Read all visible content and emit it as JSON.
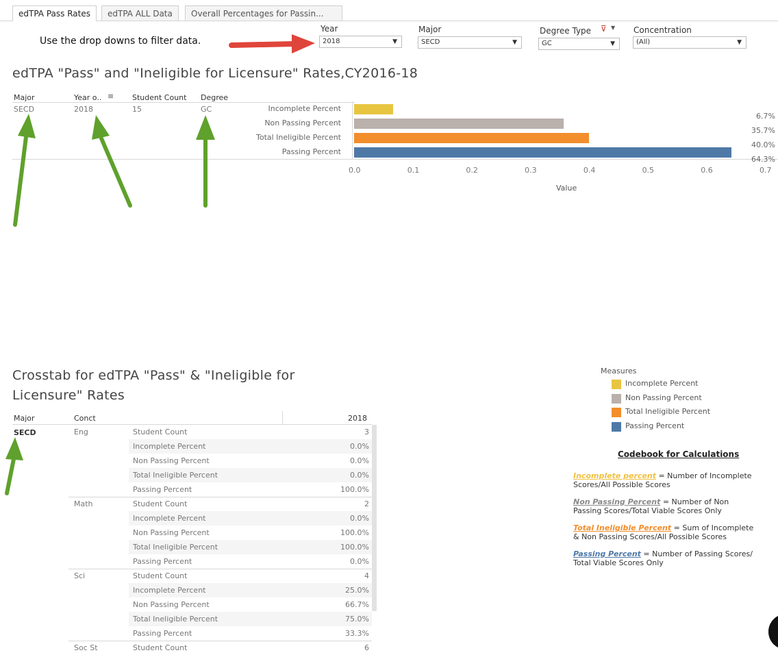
{
  "tabs": [
    {
      "label": "edTPA Pass Rates"
    },
    {
      "label": "edTPA ALL Data"
    },
    {
      "label": "Overall Percentages for Passin..."
    }
  ],
  "hint": "Use the drop downs to filter data.",
  "filters": {
    "year": {
      "label": "Year",
      "value": "2018"
    },
    "major": {
      "label": "Major",
      "value": "SECD"
    },
    "degree_type": {
      "label": "Degree Type",
      "value": "GC"
    },
    "concentration": {
      "label": "Concentration",
      "value": "(All)"
    }
  },
  "chart_title": "edTPA \"Pass\" and \"Ineligible for Licensure\" Rates,CY2016-18",
  "summary_table": {
    "headers": [
      "Major",
      "Year o..",
      "Student Count",
      "Degree"
    ],
    "row": [
      "SECD",
      "2018",
      "15",
      "GC"
    ]
  },
  "chart_data": {
    "type": "bar",
    "orientation": "horizontal",
    "categories": [
      "Incomplete Percent",
      "Non Passing Percent",
      "Total Ineligible Percent",
      "Passing Percent"
    ],
    "values": [
      0.067,
      0.357,
      0.4,
      0.643
    ],
    "value_labels": [
      "6.7%",
      "35.7%",
      "40.0%",
      "64.3%"
    ],
    "colors": [
      "#e8c541",
      "#bab0ac",
      "#f28e2b",
      "#4e79a7"
    ],
    "xlabel": "Value",
    "xlim": [
      0,
      0.7
    ],
    "ticks": [
      "0.0",
      "0.1",
      "0.2",
      "0.3",
      "0.4",
      "0.5",
      "0.6",
      "0.7"
    ]
  },
  "crosstab": {
    "title_line1": "Crosstab for edTPA \"Pass\" & \"Ineligible for",
    "title_line2": "Licensure\" Rates",
    "headers": {
      "major": "Major",
      "conct": "Conct",
      "year": "2018"
    },
    "major": "SECD",
    "groups": [
      {
        "name": "Eng",
        "rows": [
          [
            "Student Count",
            "3"
          ],
          [
            "Incomplete Percent",
            "0.0%"
          ],
          [
            "Non Passing Percent",
            "0.0%"
          ],
          [
            "Total Ineligible Percent",
            "0.0%"
          ],
          [
            "Passing Percent",
            "100.0%"
          ]
        ]
      },
      {
        "name": "Math",
        "rows": [
          [
            "Student Count",
            "2"
          ],
          [
            "Incomplete Percent",
            "0.0%"
          ],
          [
            "Non Passing Percent",
            "100.0%"
          ],
          [
            "Total Ineligible Percent",
            "100.0%"
          ],
          [
            "Passing Percent",
            "0.0%"
          ]
        ]
      },
      {
        "name": "Sci",
        "rows": [
          [
            "Student Count",
            "4"
          ],
          [
            "Incomplete Percent",
            "25.0%"
          ],
          [
            "Non Passing Percent",
            "66.7%"
          ],
          [
            "Total Ineligible Percent",
            "75.0%"
          ],
          [
            "Passing Percent",
            "33.3%"
          ]
        ]
      },
      {
        "name": "Soc St",
        "rows": [
          [
            "Student Count",
            "6"
          ]
        ]
      }
    ]
  },
  "legend": {
    "title": "Measures",
    "items": [
      "Incomplete Percent",
      "Non Passing Percent",
      "Total Ineligible Percent",
      "Passing Percent"
    ]
  },
  "codebook": {
    "title": "Codebook for Calculations",
    "entries": [
      {
        "term": "Incomplete percent",
        "line1": " = Number of Incomplete",
        "line2": "Scores/All Possible Scores",
        "color": "#f0c040"
      },
      {
        "term": "Non Passing Percent",
        "line1": " = Number of Non",
        "line2": "Passing Scores/Total Viable Scores Only",
        "color": "#8a8a8a"
      },
      {
        "term": "Total Ineligible Percent",
        "line1": " = Sum of Incomplete",
        "line2": "& Non Passing Scores/All Possible Scores",
        "color": "#f28e2b"
      },
      {
        "term": "Passing Percent",
        "line1": " = Number of Passing Scores/",
        "line2": "Total Viable Scores Only",
        "color": "#4e79a7"
      }
    ]
  }
}
